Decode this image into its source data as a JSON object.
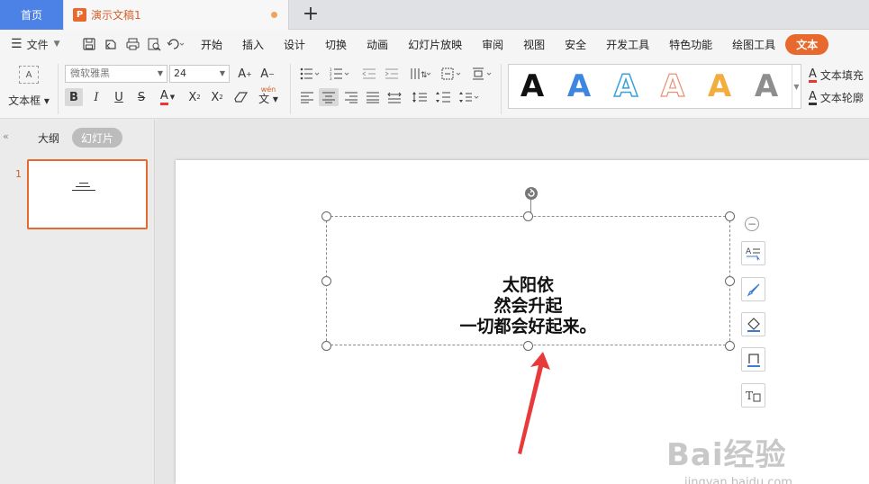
{
  "tabs": {
    "home": "首页",
    "doc_icon": "P",
    "doc_title": "演示文稿1",
    "new_tab": "+"
  },
  "menu": {
    "file": "文件",
    "items": [
      "开始",
      "插入",
      "设计",
      "切换",
      "动画",
      "幻灯片放映",
      "审阅",
      "视图",
      "安全",
      "开发工具",
      "特色功能",
      "绘图工具",
      "文本"
    ],
    "active_index": 12
  },
  "ribbon": {
    "textbox_label": "文本框",
    "textbox_icon_text": "A",
    "font_name": "微软雅黑",
    "font_size": "24",
    "superscript_label": "wén",
    "style_letter": "A",
    "text_fill": "文本填充",
    "text_outline": "文本轮廓"
  },
  "left_panel": {
    "outline_tab": "大纲",
    "slides_tab": "幻灯片",
    "slide_number": "1"
  },
  "slide": {
    "lines": [
      "太阳依",
      "然会升起",
      "一切都会好起来。"
    ]
  },
  "watermark": {
    "main": "Bai经验",
    "sub": "jingyan.baidu.com"
  },
  "colors": {
    "accent": "#e8692d",
    "home_tab": "#4c82e6",
    "arrow": "#e83a3a"
  }
}
